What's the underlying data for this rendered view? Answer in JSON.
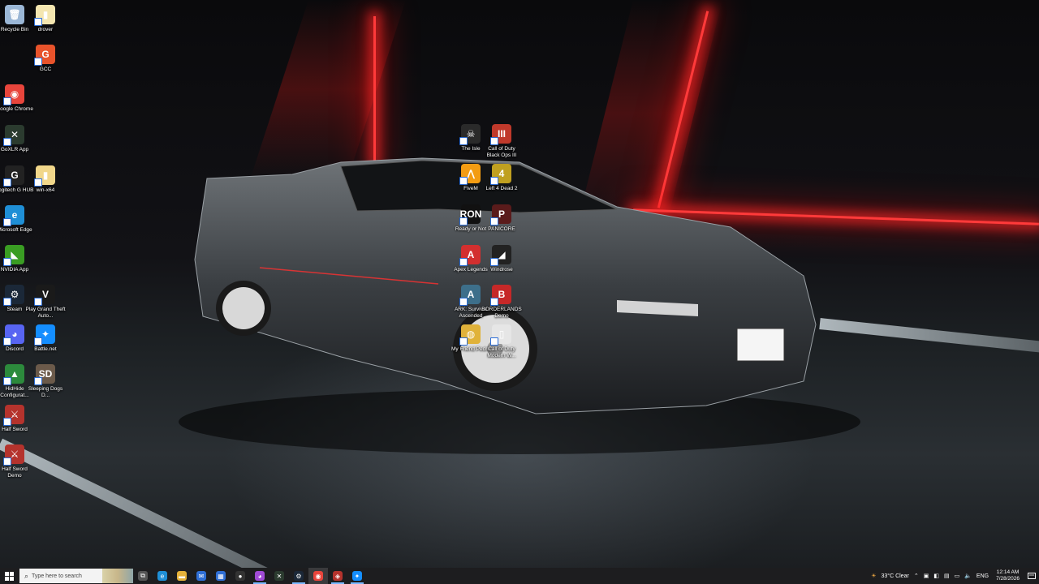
{
  "desktop": {
    "icons": [
      {
        "label": "Recycle Bin",
        "glyph": "🗑",
        "color": "#9bb7d6"
      },
      {
        "label": "drover",
        "glyph": "▮",
        "color": "#f4e6b0"
      },
      {
        "label": "GCC",
        "glyph": "G",
        "color": "#e8532b"
      },
      {
        "label": "Google Chrome",
        "glyph": "◉",
        "color": "#e8453c"
      },
      {
        "label": "GoXLR App",
        "glyph": "✕",
        "color": "#2b3b2f"
      },
      {
        "label": "Logitech G HUB",
        "glyph": "G",
        "color": "#222222"
      },
      {
        "label": "win-x64",
        "glyph": "▮",
        "color": "#f1d78a"
      },
      {
        "label": "Microsoft Edge",
        "glyph": "e",
        "color": "#1f8fd6"
      },
      {
        "label": "NVIDIA App",
        "glyph": "◣",
        "color": "#3a9d23"
      },
      {
        "label": "Steam",
        "glyph": "⚙",
        "color": "#1b2838"
      },
      {
        "label": "Play Grand Theft Auto...",
        "glyph": "V",
        "color": "#1a1a1a"
      },
      {
        "label": "Discord",
        "glyph": "◕",
        "color": "#5865f2"
      },
      {
        "label": "Battle.net",
        "glyph": "✦",
        "color": "#148eff"
      },
      {
        "label": "HidHide Configurat...",
        "glyph": "▲",
        "color": "#2c8a3c"
      },
      {
        "label": "Sleeping Dogs D...",
        "glyph": "SD",
        "color": "#6b5a4a"
      },
      {
        "label": "Half Sword",
        "glyph": "⚔",
        "color": "#b5332d"
      },
      {
        "label": "Half Sword Demo",
        "glyph": "⚔",
        "color": "#b5332d"
      },
      {
        "label": "The Isle",
        "glyph": "☠",
        "color": "#2a2a2a"
      },
      {
        "label": "Call of Duty Black Ops III",
        "glyph": "III",
        "color": "#c0392b"
      },
      {
        "label": "FiveM",
        "glyph": "⋀",
        "color": "#f39c12"
      },
      {
        "label": "Left 4 Dead 2",
        "glyph": "4",
        "color": "#c0a020"
      },
      {
        "label": "Ready or Not",
        "glyph": "RON",
        "color": "#111111"
      },
      {
        "label": "PANICORE",
        "glyph": "P",
        "color": "#5a1b1b"
      },
      {
        "label": "Apex Legends",
        "glyph": "A",
        "color": "#d32f2f"
      },
      {
        "label": "Windrose",
        "glyph": "◢",
        "color": "#222222"
      },
      {
        "label": "ARK: Survival Ascended",
        "glyph": "A",
        "color": "#3d6f8a"
      },
      {
        "label": "BORDERLANDS Demo",
        "glyph": "B",
        "color": "#c62828"
      },
      {
        "label": "My Friend Pedro",
        "glyph": "◍",
        "color": "#e0b23a"
      },
      {
        "label": "Call of Duty Modern W...",
        "glyph": "▯",
        "color": "#e6e6e6"
      }
    ]
  },
  "taskbar": {
    "search_placeholder": "Type here to search",
    "apps": [
      {
        "name": "task-view",
        "glyph": "⧉",
        "color": "#555",
        "state": ""
      },
      {
        "name": "edge",
        "glyph": "e",
        "color": "#1f8fd6",
        "state": ""
      },
      {
        "name": "file-explorer",
        "glyph": "▬",
        "color": "#e6b23a",
        "state": ""
      },
      {
        "name": "mail",
        "glyph": "✉",
        "color": "#2f6fd6",
        "state": ""
      },
      {
        "name": "store",
        "glyph": "▦",
        "color": "#2f6fd6",
        "state": ""
      },
      {
        "name": "obs",
        "glyph": "●",
        "color": "#333",
        "state": ""
      },
      {
        "name": "messenger",
        "glyph": "◕",
        "color": "#a14bd6",
        "state": "running"
      },
      {
        "name": "goxlr",
        "glyph": "✕",
        "color": "#2b3b2f",
        "state": ""
      },
      {
        "name": "steam",
        "glyph": "⚙",
        "color": "#1b2838",
        "state": "running"
      },
      {
        "name": "chrome",
        "glyph": "◉",
        "color": "#e8453c",
        "state": "active"
      },
      {
        "name": "app-red",
        "glyph": "◈",
        "color": "#b5332d",
        "state": "running"
      },
      {
        "name": "battle-net",
        "glyph": "✦",
        "color": "#148eff",
        "state": "running"
      }
    ],
    "weather": "33°C  Clear",
    "language": "ENG",
    "time": "12:14 AM",
    "date": "7/28/2026"
  }
}
